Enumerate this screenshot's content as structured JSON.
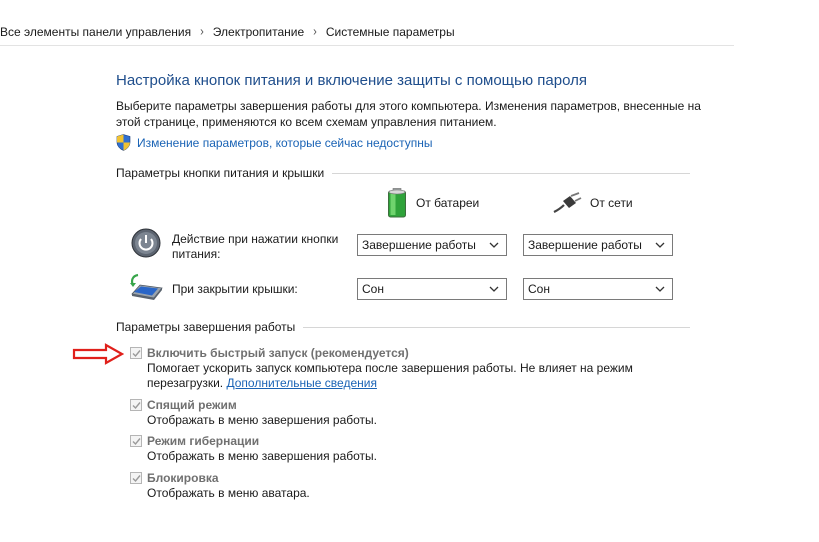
{
  "breadcrumb": {
    "items": [
      "Все элементы панели управления",
      "Электропитание",
      "Системные параметры"
    ],
    "separator": "›"
  },
  "page": {
    "title": "Настройка кнопок питания и включение защиты с помощью пароля",
    "description": "Выберите параметры завершения работы для этого компьютера. Изменения параметров, внесенные на этой странице, применяются ко всем схемам управления питанием.",
    "change_link": "Изменение параметров, которые сейчас недоступны"
  },
  "power_buttons": {
    "section_title": "Параметры кнопки питания и крышки",
    "col_battery": "От батареи",
    "col_ac": "От сети",
    "rows": [
      {
        "label": "Действие при нажатии кнопки питания:",
        "battery": "Завершение работы",
        "ac": "Завершение работы"
      },
      {
        "label": "При закрытии крышки:",
        "battery": "Сон",
        "ac": "Сон"
      }
    ]
  },
  "shutdown": {
    "section_title": "Параметры завершения работы",
    "options": [
      {
        "title": "Включить быстрый запуск (рекомендуется)",
        "desc": "Помогает ускорить запуск компьютера после завершения работы. Не влияет на режим перезагрузки.",
        "link": "Дополнительные сведения",
        "checked": true
      },
      {
        "title": "Спящий режим",
        "desc": "Отображать в меню завершения работы.",
        "checked": true
      },
      {
        "title": "Режим гибернации",
        "desc": "Отображать в меню завершения работы.",
        "checked": true
      },
      {
        "title": "Блокировка",
        "desc": "Отображать в меню аватара.",
        "checked": true
      }
    ]
  },
  "colors": {
    "title_blue": "#1f4e8c",
    "link_blue": "#1a63b5",
    "arrow_red": "#e0201b",
    "disabled_gray": "#707070"
  },
  "icons": [
    "shield-icon",
    "battery-icon",
    "power-plug-icon",
    "power-button-icon",
    "laptop-lid-icon",
    "checkmark-icon",
    "chevron-down-icon",
    "red-arrow-icon"
  ]
}
